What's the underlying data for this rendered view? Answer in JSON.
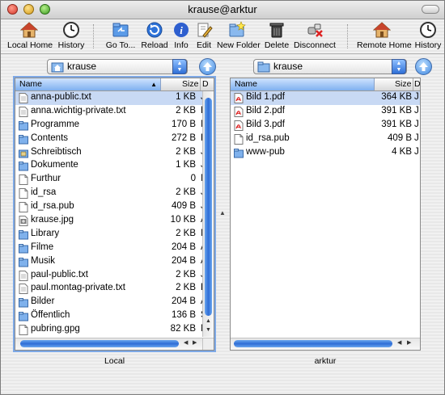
{
  "window": {
    "title": "krause@arktur"
  },
  "toolbar": {
    "local_home": "Local Home",
    "history": "History",
    "goto": "Go To...",
    "reload": "Reload",
    "info": "Info",
    "edit": "Edit",
    "new_folder": "New Folder",
    "delete": "Delete",
    "disconnect": "Disconnect",
    "remote_home": "Remote Home",
    "history2": "History"
  },
  "local": {
    "path": "krause",
    "label": "Local",
    "col_name": "Name",
    "col_size": "Size",
    "col_date": "D",
    "files": [
      {
        "name": "anna-public.txt",
        "size": "1 KB",
        "date": "J",
        "kind": "txt"
      },
      {
        "name": "anna.wichtig-private.txt",
        "size": "2 KB",
        "date": "F",
        "kind": "txt"
      },
      {
        "name": "Programme",
        "size": "170 B",
        "date": "N",
        "kind": "folder"
      },
      {
        "name": "Contents",
        "size": "272 B",
        "date": "D",
        "kind": "folder"
      },
      {
        "name": "Schreibtisch",
        "size": "2 KB",
        "date": "J",
        "kind": "desk"
      },
      {
        "name": "Dokumente",
        "size": "1 KB",
        "date": "J",
        "kind": "folder"
      },
      {
        "name": "Furthur",
        "size": "0",
        "date": "N",
        "kind": "file"
      },
      {
        "name": "id_rsa",
        "size": "2 KB",
        "date": "J",
        "kind": "file"
      },
      {
        "name": "id_rsa.pub",
        "size": "409 B",
        "date": "J",
        "kind": "file"
      },
      {
        "name": "krause.jpg",
        "size": "10 KB",
        "date": "A",
        "kind": "img"
      },
      {
        "name": "Library",
        "size": "2 KB",
        "date": "M",
        "kind": "folder"
      },
      {
        "name": "Filme",
        "size": "204 B",
        "date": "A",
        "kind": "folder"
      },
      {
        "name": "Musik",
        "size": "204 B",
        "date": "A",
        "kind": "folder"
      },
      {
        "name": "paul-public.txt",
        "size": "2 KB",
        "date": "J",
        "kind": "txt"
      },
      {
        "name": "paul.montag-private.txt",
        "size": "2 KB",
        "date": "F",
        "kind": "txt"
      },
      {
        "name": "Bilder",
        "size": "204 B",
        "date": "A",
        "kind": "folder"
      },
      {
        "name": "Öffentlich",
        "size": "136 B",
        "date": "S",
        "kind": "folder"
      },
      {
        "name": "pubring.gpg",
        "size": "82 KB",
        "date": "M",
        "kind": "file"
      }
    ]
  },
  "remote": {
    "path": "krause",
    "label": "arktur",
    "col_name": "Name",
    "col_size": "Size",
    "col_date": "D",
    "files": [
      {
        "name": "Bild 1.pdf",
        "size": "364 KB",
        "date": "J",
        "kind": "pdf"
      },
      {
        "name": "Bild 2.pdf",
        "size": "391 KB",
        "date": "J",
        "kind": "pdf"
      },
      {
        "name": "Bild 3.pdf",
        "size": "391 KB",
        "date": "J",
        "kind": "pdf"
      },
      {
        "name": "id_rsa.pub",
        "size": "409 B",
        "date": "J",
        "kind": "file"
      },
      {
        "name": "www-pub",
        "size": "4 KB",
        "date": "J",
        "kind": "folder"
      }
    ]
  },
  "colors": {
    "accent": "#3a75d6",
    "selection": "#c8d9f4",
    "header_sort": "#7fb0ef"
  }
}
